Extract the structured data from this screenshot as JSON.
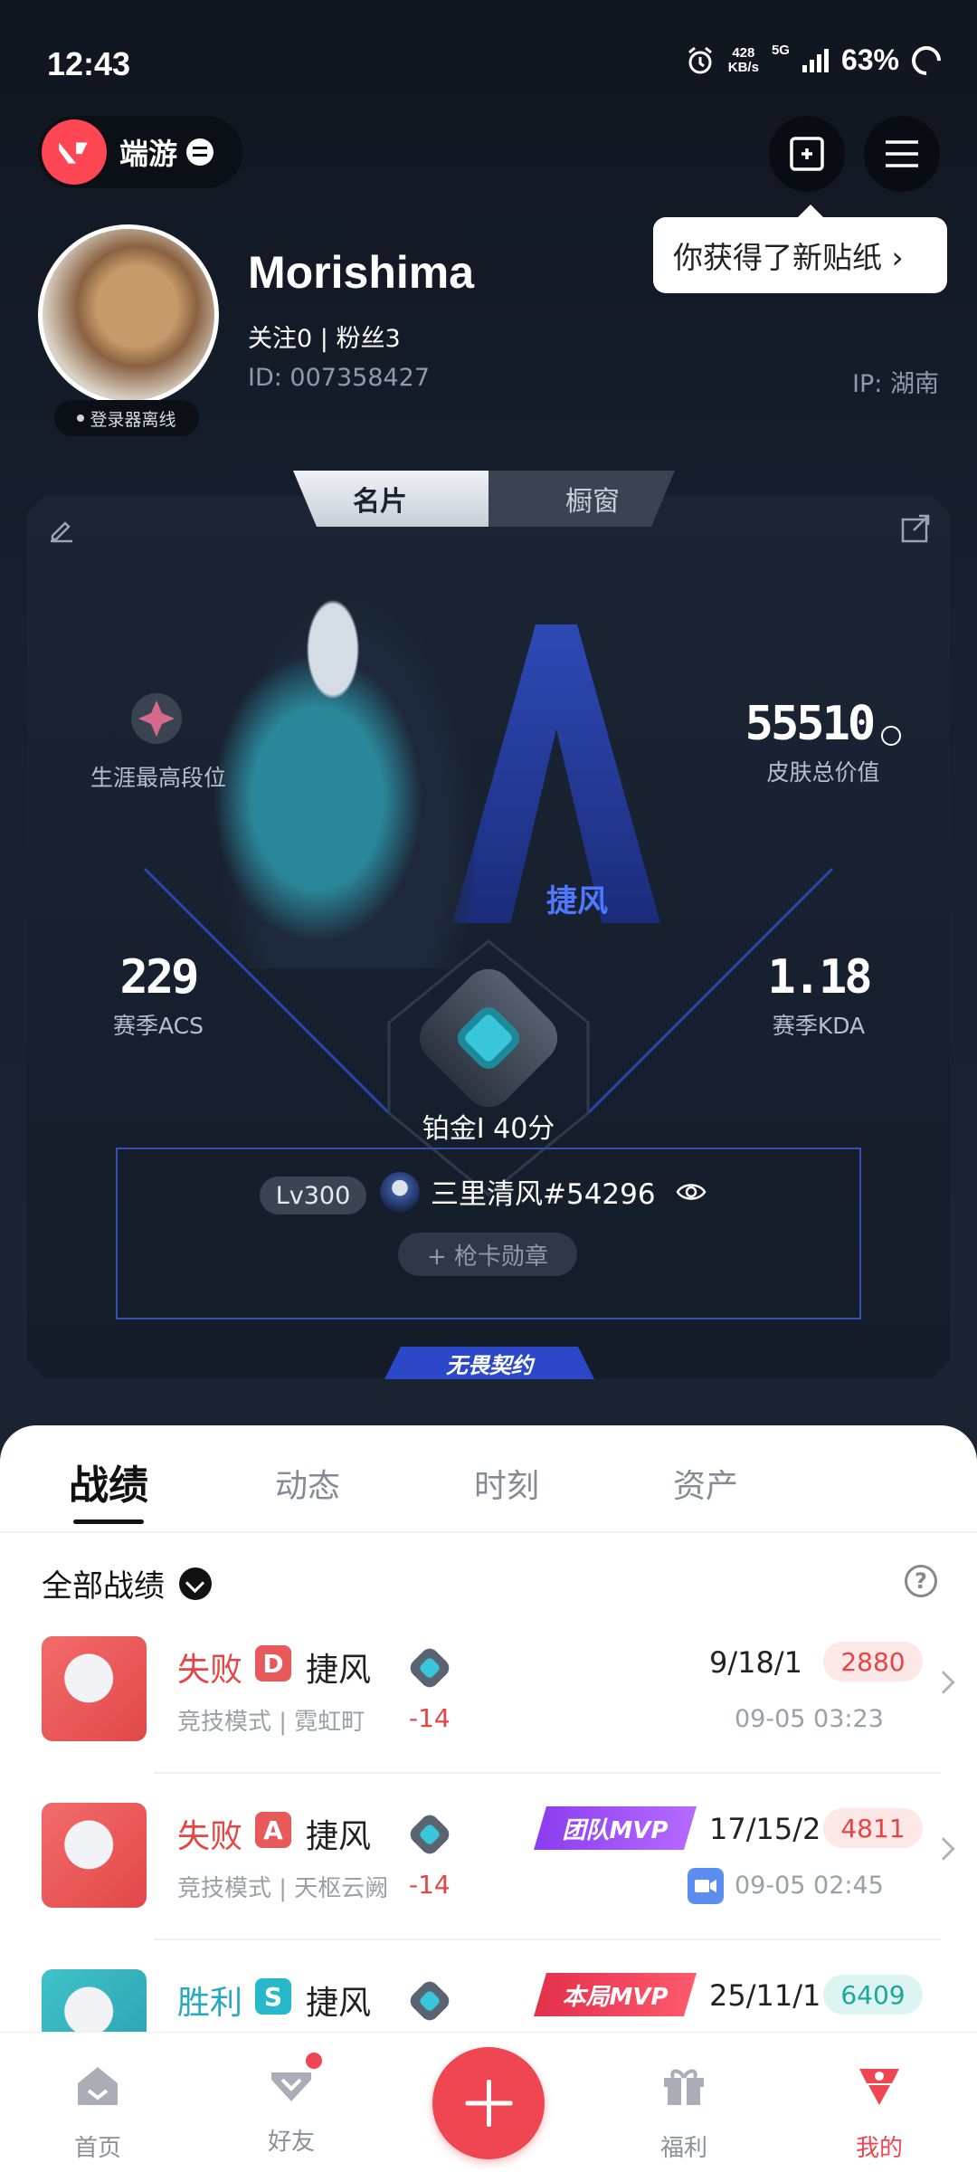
{
  "status": {
    "time": "12:43",
    "speed": "428",
    "speed_unit": "KB/s",
    "network": "5G",
    "battery": "63%"
  },
  "header": {
    "app_name": "端游",
    "tooltip": "你获得了新贴纸 ›"
  },
  "profile": {
    "name": "Morishima",
    "follow_line": "关注0   |   粉丝3",
    "id_line": "ID:  007358427",
    "ip_line": "IP:  湖南",
    "login_status": "登录器离线"
  },
  "card_tabs": [
    "名片",
    "橱窗"
  ],
  "card": {
    "rank_label": "生涯最高段位",
    "skin_value": "55510",
    "skin_label": "皮肤总价值",
    "acs_value": "229",
    "acs_label": "赛季ACS",
    "kda_value": "1.18",
    "kda_label": "赛季KDA",
    "agent_name": "捷风",
    "rank_text": "铂金I 40分",
    "level": "Lv300",
    "player_tag": "三里清风#54296",
    "gun_badge": "+ 枪卡勋章",
    "contract": "无畏契约"
  },
  "sheet_tabs": [
    "战绩",
    "动态",
    "时刻",
    "资产"
  ],
  "filter_label": "全部战绩",
  "matches": [
    {
      "result": "失败",
      "result_color": "#e64545",
      "badge": "D",
      "badge_color": "#e85a5a",
      "agent": "捷风",
      "mode": "竞技模式 | 霓虹町",
      "delta": "-14",
      "mvp": "",
      "kda": "9/18/1",
      "acs": "2880",
      "acs_bg": "#fde7e7",
      "acs_color": "#e64545",
      "date": "09-05 03:23"
    },
    {
      "result": "失败",
      "result_color": "#e64545",
      "badge": "A",
      "badge_color": "#e85a5a",
      "agent": "捷风",
      "mode": "竞技模式 | 天枢云阙",
      "delta": "-14",
      "mvp": "团队MVP",
      "kda": "17/15/2",
      "acs": "4811",
      "acs_bg": "#fde7e7",
      "acs_color": "#e64545",
      "date": "09-05 02:45"
    },
    {
      "result": "胜利",
      "result_color": "#27a9c1",
      "badge": "S",
      "badge_color": "#27b8c9",
      "agent": "捷风",
      "mode": "",
      "delta": "",
      "mvp": "本局MVP",
      "kda": "25/11/1",
      "acs": "6409",
      "acs_bg": "#ddf5f2",
      "acs_color": "#1aa89a",
      "date": ""
    }
  ],
  "nav": [
    "首页",
    "好友",
    "福利",
    "我的"
  ]
}
